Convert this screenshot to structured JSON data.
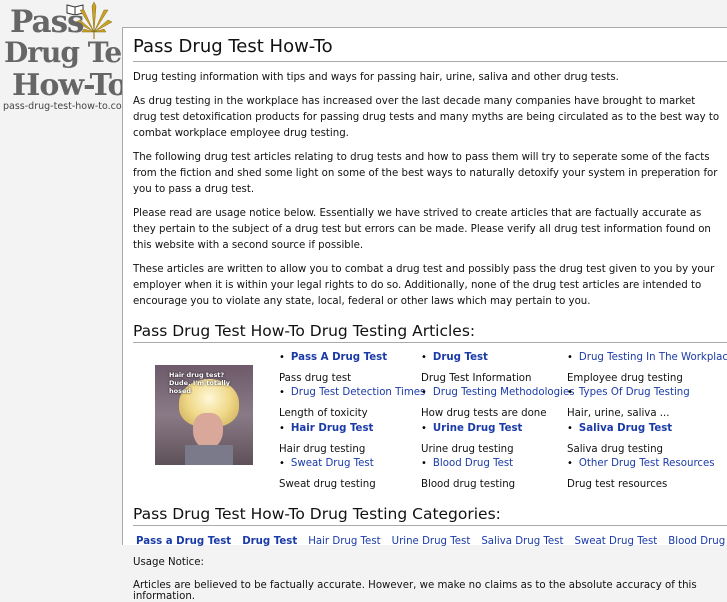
{
  "logo": {
    "line1": "Pass",
    "line2": "Drug Test",
    "line3": "How-To",
    "url": "pass-drug-test-how-to.com"
  },
  "page_title": "Pass Drug Test How-To",
  "intro": [
    "Drug testing information with tips and ways for passing hair, urine, saliva and other drug tests.",
    "As drug testing in the workplace has increased over the last decade many companies have brought to market drug test detoxification products for passing drug tests and many myths are being circulated as to the best way to combat workplace employee drug testing.",
    "The following drug test articles relating to drug tests and how to pass them will try to seperate some of the facts from the fiction and shed some light on some of the best ways to naturally detoxify your system in preperation for you to pass a drug test.",
    "Please read are usage notice below. Essentially we have strived to create articles that are factually accurate as they pertain to the subject of a drug test but errors can be made. Please verify all drug test information found on this website with a second source if possible.",
    "These articles are written to allow you to combat a drug test and possibly pass the drug test given to you by your employer when it is within your legal rights to do so. Additionally, none of the drug test articles are intended to encourage you to violate any state, local, federal or other laws which may pertain to you."
  ],
  "articles_heading": "Pass Drug Test How-To Drug Testing Articles:",
  "photo_caption": "Hair drug test? Dude, I'm totally hosed",
  "articles": [
    {
      "title": "Pass A Drug Test",
      "desc": "Pass drug test",
      "bold": true
    },
    {
      "title": "Drug Test",
      "desc": "Drug Test Information",
      "bold": true
    },
    {
      "title": "Drug Testing In The Workplace",
      "desc": "Employee drug testing",
      "bold": false
    },
    {
      "title": "Drug Test Detection Times",
      "desc": "Length of toxicity",
      "bold": false
    },
    {
      "title": "Drug Testing Methodologies",
      "desc": "How drug tests are done",
      "bold": false
    },
    {
      "title": "Types Of Drug Testing",
      "desc": "Hair, urine, saliva ...",
      "bold": false
    },
    {
      "title": "Hair Drug Test",
      "desc": "Hair drug testing",
      "bold": true
    },
    {
      "title": "Urine Drug Test",
      "desc": "Urine drug testing",
      "bold": true
    },
    {
      "title": "Saliva Drug Test",
      "desc": "Saliva drug testing",
      "bold": true
    },
    {
      "title": "Sweat Drug Test",
      "desc": "Sweat drug testing",
      "bold": false
    },
    {
      "title": "Blood Drug Test",
      "desc": "Blood drug testing",
      "bold": false
    },
    {
      "title": "Other Drug Test Resources",
      "desc": "Drug test resources",
      "bold": false
    }
  ],
  "categories_heading": "Pass Drug Test How-To Drug Testing Categories:",
  "categories": [
    {
      "label": "Pass a Drug Test",
      "bold": true
    },
    {
      "label": "Drug Test",
      "bold": true
    },
    {
      "label": "Hair Drug Test",
      "bold": false
    },
    {
      "label": "Urine Drug Test",
      "bold": false
    },
    {
      "label": "Saliva Drug Test",
      "bold": false
    },
    {
      "label": "Sweat Drug Test",
      "bold": false
    },
    {
      "label": "Blood Drug Test",
      "bold": false
    }
  ],
  "usage_notice_label": "Usage Notice:",
  "usage_notice_text": "Articles are believed to be factually accurate. However, we make no claims as to the absolute accuracy of this information."
}
